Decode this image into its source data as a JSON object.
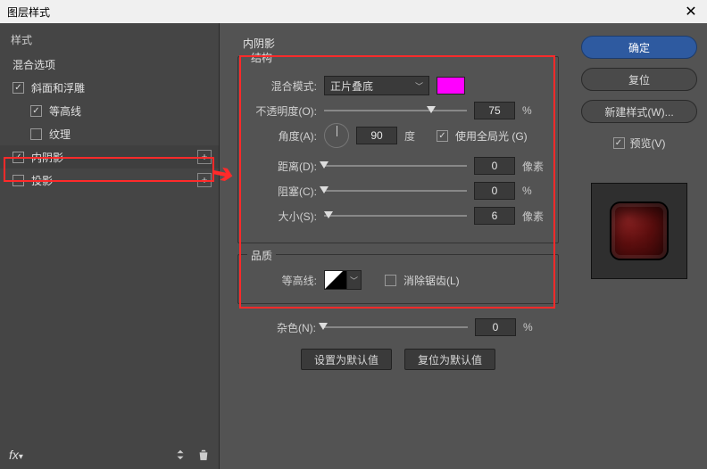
{
  "window": {
    "title": "图层样式",
    "close": "✕"
  },
  "sidebar": {
    "header": "样式",
    "blend_options": "混合选项",
    "items": [
      {
        "label": "斜面和浮雕",
        "checked": true,
        "indent": false,
        "add": false
      },
      {
        "label": "等高线",
        "checked": true,
        "indent": true,
        "add": false
      },
      {
        "label": "纹理",
        "checked": false,
        "indent": true,
        "add": false
      },
      {
        "label": "内阴影",
        "checked": true,
        "indent": false,
        "add": true,
        "selected": true
      },
      {
        "label": "投影",
        "checked": false,
        "indent": false,
        "add": true
      }
    ],
    "footer_fx": "fx"
  },
  "panel": {
    "title": "内阴影",
    "group_structure": "结构",
    "blend_mode_label": "混合模式:",
    "blend_mode_value": "正片叠底",
    "swatch_color": "#ff00ff",
    "opacity_label": "不透明度(O):",
    "opacity_value": "75",
    "opacity_unit": "%",
    "angle_label": "角度(A):",
    "angle_value": "90",
    "angle_unit": "度",
    "global_light_label": "使用全局光 (G)",
    "global_light_checked": true,
    "distance_label": "距离(D):",
    "distance_value": "0",
    "distance_unit": "像素",
    "choke_label": "阻塞(C):",
    "choke_value": "0",
    "choke_unit": "%",
    "size_label": "大小(S):",
    "size_value": "6",
    "size_unit": "像素",
    "group_quality": "品质",
    "contour_label": "等高线:",
    "antialias_label": "消除锯齿(L)",
    "antialias_checked": false,
    "noise_label": "杂色(N):",
    "noise_value": "0",
    "noise_unit": "%",
    "btn_default": "设置为默认值",
    "btn_reset": "复位为默认值"
  },
  "right": {
    "ok": "确定",
    "cancel": "复位",
    "new_style": "新建样式(W)...",
    "preview_label": "预览(V)",
    "preview_checked": true
  }
}
